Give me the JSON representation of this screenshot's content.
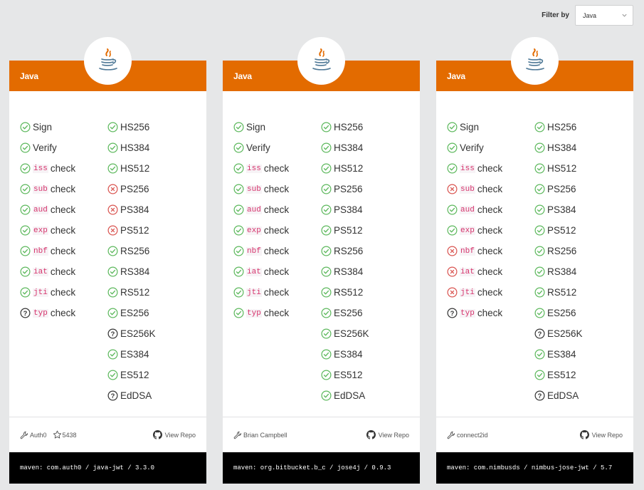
{
  "filter": {
    "label": "Filter by",
    "selected": "Java"
  },
  "colors": {
    "header": "#e36b00",
    "ok": "#5cb85c",
    "fail": "#d9534f",
    "unknown": "#333333"
  },
  "cards": [
    {
      "title": "Java",
      "left_col": [
        {
          "label": "Sign",
          "status": "ok"
        },
        {
          "label": "Verify",
          "status": "ok"
        },
        {
          "code": "iss",
          "label": "check",
          "status": "ok"
        },
        {
          "code": "sub",
          "label": "check",
          "status": "ok"
        },
        {
          "code": "aud",
          "label": "check",
          "status": "ok"
        },
        {
          "code": "exp",
          "label": "check",
          "status": "ok"
        },
        {
          "code": "nbf",
          "label": "check",
          "status": "ok"
        },
        {
          "code": "iat",
          "label": "check",
          "status": "ok"
        },
        {
          "code": "jti",
          "label": "check",
          "status": "ok"
        },
        {
          "code": "typ",
          "label": "check",
          "status": "unknown"
        }
      ],
      "right_col": [
        {
          "label": "HS256",
          "status": "ok"
        },
        {
          "label": "HS384",
          "status": "ok"
        },
        {
          "label": "HS512",
          "status": "ok"
        },
        {
          "label": "PS256",
          "status": "fail"
        },
        {
          "label": "PS384",
          "status": "fail"
        },
        {
          "label": "PS512",
          "status": "fail"
        },
        {
          "label": "RS256",
          "status": "ok"
        },
        {
          "label": "RS384",
          "status": "ok"
        },
        {
          "label": "RS512",
          "status": "ok"
        },
        {
          "label": "ES256",
          "status": "ok"
        },
        {
          "label": "ES256K",
          "status": "unknown"
        },
        {
          "label": "ES384",
          "status": "ok"
        },
        {
          "label": "ES512",
          "status": "ok"
        },
        {
          "label": "EdDSA",
          "status": "unknown"
        }
      ],
      "author": "Auth0",
      "stars": "5438",
      "repo_link": "View Repo",
      "maven": "maven: com.auth0 / java-jwt / 3.3.0"
    },
    {
      "title": "Java",
      "left_col": [
        {
          "label": "Sign",
          "status": "ok"
        },
        {
          "label": "Verify",
          "status": "ok"
        },
        {
          "code": "iss",
          "label": "check",
          "status": "ok"
        },
        {
          "code": "sub",
          "label": "check",
          "status": "ok"
        },
        {
          "code": "aud",
          "label": "check",
          "status": "ok"
        },
        {
          "code": "exp",
          "label": "check",
          "status": "ok"
        },
        {
          "code": "nbf",
          "label": "check",
          "status": "ok"
        },
        {
          "code": "iat",
          "label": "check",
          "status": "ok"
        },
        {
          "code": "jti",
          "label": "check",
          "status": "ok"
        },
        {
          "code": "typ",
          "label": "check",
          "status": "ok"
        }
      ],
      "right_col": [
        {
          "label": "HS256",
          "status": "ok"
        },
        {
          "label": "HS384",
          "status": "ok"
        },
        {
          "label": "HS512",
          "status": "ok"
        },
        {
          "label": "PS256",
          "status": "ok"
        },
        {
          "label": "PS384",
          "status": "ok"
        },
        {
          "label": "PS512",
          "status": "ok"
        },
        {
          "label": "RS256",
          "status": "ok"
        },
        {
          "label": "RS384",
          "status": "ok"
        },
        {
          "label": "RS512",
          "status": "ok"
        },
        {
          "label": "ES256",
          "status": "ok"
        },
        {
          "label": "ES256K",
          "status": "ok"
        },
        {
          "label": "ES384",
          "status": "ok"
        },
        {
          "label": "ES512",
          "status": "ok"
        },
        {
          "label": "EdDSA",
          "status": "ok"
        }
      ],
      "author": "Brian Campbell",
      "stars": "",
      "repo_link": "View Repo",
      "maven": "maven: org.bitbucket.b_c / jose4j / 0.9.3"
    },
    {
      "title": "Java",
      "left_col": [
        {
          "label": "Sign",
          "status": "ok"
        },
        {
          "label": "Verify",
          "status": "ok"
        },
        {
          "code": "iss",
          "label": "check",
          "status": "ok"
        },
        {
          "code": "sub",
          "label": "check",
          "status": "fail"
        },
        {
          "code": "aud",
          "label": "check",
          "status": "ok"
        },
        {
          "code": "exp",
          "label": "check",
          "status": "ok"
        },
        {
          "code": "nbf",
          "label": "check",
          "status": "fail"
        },
        {
          "code": "iat",
          "label": "check",
          "status": "fail"
        },
        {
          "code": "jti",
          "label": "check",
          "status": "fail"
        },
        {
          "code": "typ",
          "label": "check",
          "status": "unknown"
        }
      ],
      "right_col": [
        {
          "label": "HS256",
          "status": "ok"
        },
        {
          "label": "HS384",
          "status": "ok"
        },
        {
          "label": "HS512",
          "status": "ok"
        },
        {
          "label": "PS256",
          "status": "ok"
        },
        {
          "label": "PS384",
          "status": "ok"
        },
        {
          "label": "PS512",
          "status": "ok"
        },
        {
          "label": "RS256",
          "status": "ok"
        },
        {
          "label": "RS384",
          "status": "ok"
        },
        {
          "label": "RS512",
          "status": "ok"
        },
        {
          "label": "ES256",
          "status": "ok"
        },
        {
          "label": "ES256K",
          "status": "unknown"
        },
        {
          "label": "ES384",
          "status": "ok"
        },
        {
          "label": "ES512",
          "status": "ok"
        },
        {
          "label": "EdDSA",
          "status": "unknown"
        }
      ],
      "author": "connect2id",
      "stars": "",
      "repo_link": "View Repo",
      "maven": "maven: com.nimbusds / nimbus-jose-jwt / 5.7"
    }
  ]
}
